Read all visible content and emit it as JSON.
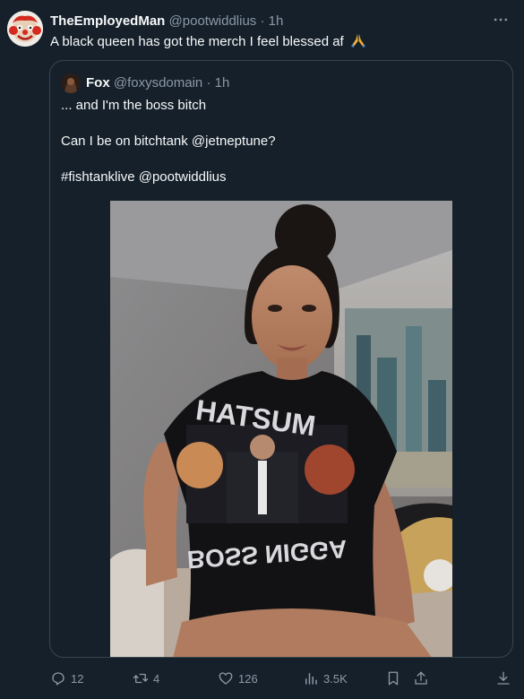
{
  "post": {
    "display_name": "TheEmployedMan",
    "handle": "@pootwiddlius",
    "separator": "·",
    "time": "1h",
    "text": "A black queen has got the merch I feel blessed af",
    "more_icon": "more-horizontal-icon"
  },
  "quote": {
    "display_name": "Fox",
    "handle": "@foxysdomain",
    "separator": "·",
    "time": "1h",
    "lines": [
      "... and I'm the boss bitch",
      "Can I be on bitchtank @jetneptune?",
      "#fishtanklive @pootwiddlius"
    ],
    "image": {
      "shirt_text_top": "HATSUM",
      "shirt_text_bottom": "BOSS NIGGA"
    }
  },
  "actions": {
    "replies": "12",
    "reposts": "4",
    "likes": "126",
    "views": "3.5K"
  },
  "colors": {
    "background": "#15202b",
    "border": "#38444d",
    "muted": "#8b98a5",
    "text": "#f7f9f9"
  }
}
